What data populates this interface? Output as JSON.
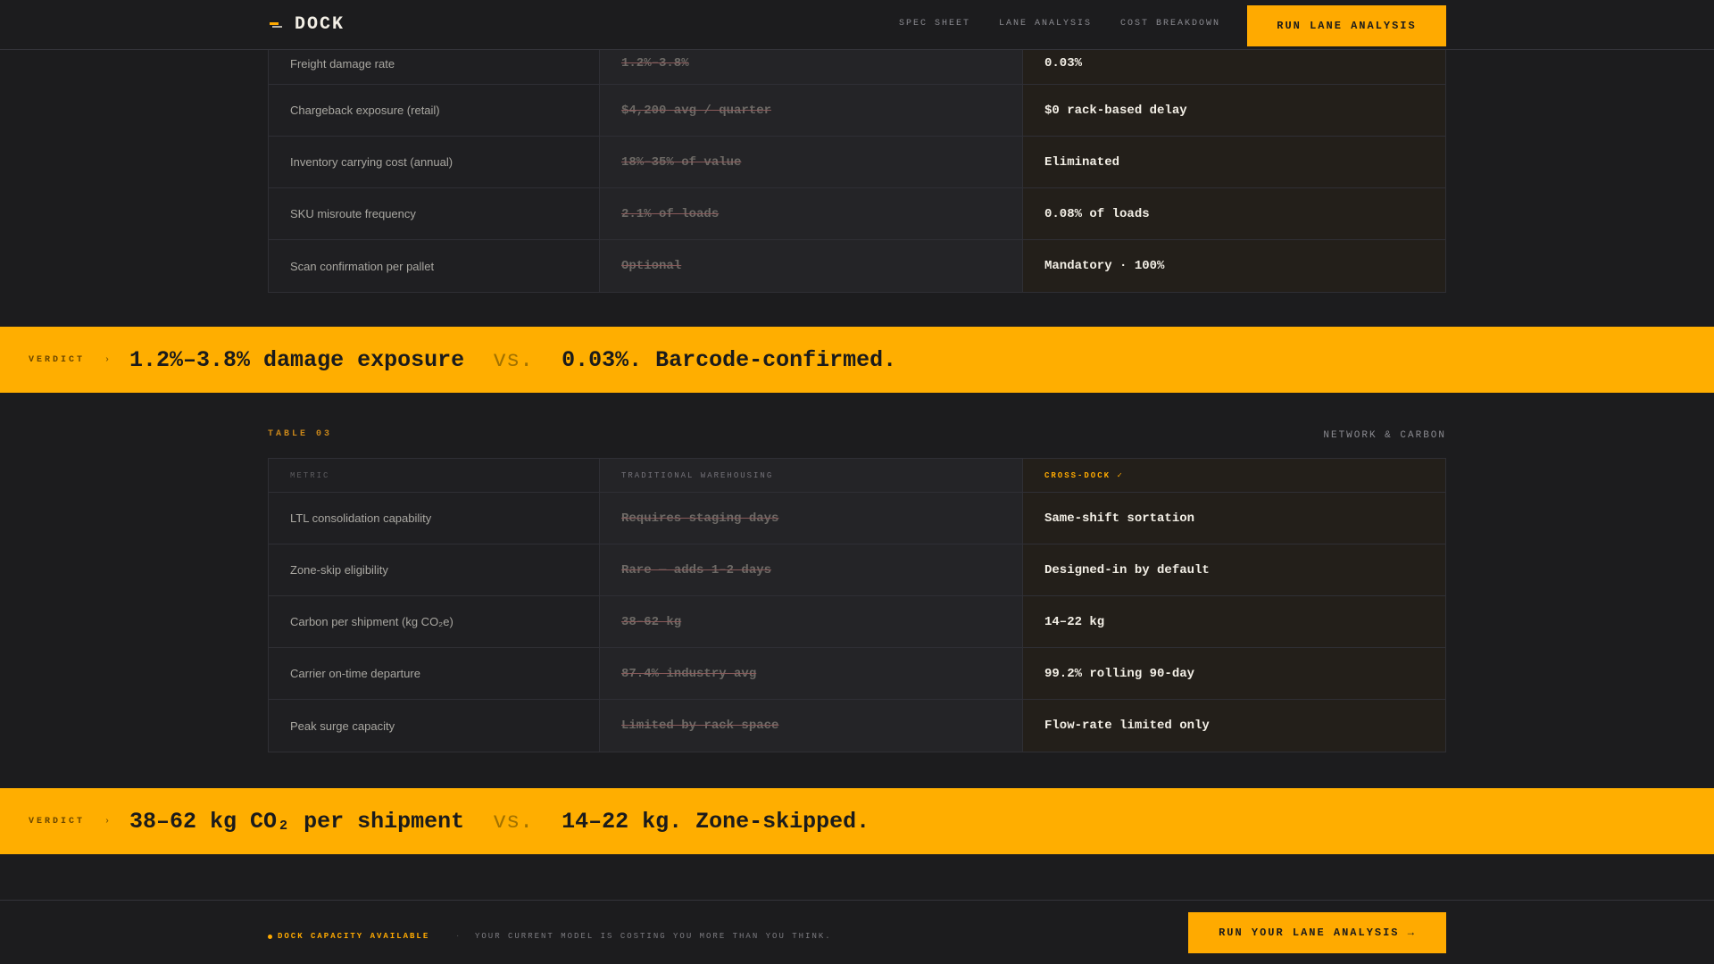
{
  "header": {
    "logo_text": "DOCK",
    "logo_icon": "dock-logo-icon",
    "nav": [
      "SPEC SHEET",
      "LANE ANALYSIS",
      "COST BREAKDOWN"
    ],
    "cta": "RUN LANE ANALYSIS"
  },
  "table02": {
    "rows": [
      {
        "metric": "Freight damage rate",
        "traditional": "1.2%–3.8%",
        "crossdock": "0.03%"
      },
      {
        "metric": "Chargeback exposure (retail)",
        "traditional": "$4,200 avg / quarter",
        "crossdock": "$0 rack-based delay"
      },
      {
        "metric": "Inventory carrying cost (annual)",
        "traditional": "18%–35% of value",
        "crossdock": "Eliminated"
      },
      {
        "metric": "SKU misroute frequency",
        "traditional": "2.1% of loads",
        "crossdock": "0.08% of loads"
      },
      {
        "metric": "Scan confirmation per pallet",
        "traditional": "Optional",
        "crossdock": "Mandatory · 100%"
      }
    ]
  },
  "verdict1": {
    "label": "VERDICT",
    "arrow": "›",
    "left": "1.2%–3.8% damage exposure",
    "vs": "vs.",
    "right": "0.03%. Barcode-confirmed."
  },
  "table03": {
    "tag": "TABLE 03",
    "subtitle": "NETWORK & CARBON",
    "headers": {
      "metric": "METRIC",
      "traditional": "TRADITIONAL WAREHOUSING",
      "crossdock": "CROSS-DOCK ✓"
    },
    "rows": [
      {
        "metric": "LTL consolidation capability",
        "traditional": "Requires staging days",
        "crossdock": "Same-shift sortation"
      },
      {
        "metric": "Zone-skip eligibility",
        "traditional": "Rare — adds 1–2 days",
        "crossdock": "Designed-in by default"
      },
      {
        "metric": "Carbon per shipment (kg CO₂e)",
        "traditional": "38–62 kg",
        "crossdock": "14–22 kg"
      },
      {
        "metric": "Carrier on-time departure",
        "traditional": "87.4% industry avg",
        "crossdock": "99.2% rolling 90-day"
      },
      {
        "metric": "Peak surge capacity",
        "traditional": "Limited by rack space",
        "crossdock": "Flow-rate limited only"
      }
    ]
  },
  "verdict2": {
    "label": "VERDICT",
    "arrow": "›",
    "left": "38–62 kg CO₂ per shipment",
    "vs": "vs.",
    "right": "14–22 kg. Zone-skipped."
  },
  "footer": {
    "status": "DOCK CAPACITY AVAILABLE",
    "separator": "·",
    "message": "YOUR CURRENT MODEL IS COSTING YOU MORE THAN YOU THINK.",
    "cta": "RUN YOUR LANE ANALYSIS →"
  },
  "colors": {
    "accent": "#ffaa00",
    "background": "#1c1c1e"
  }
}
